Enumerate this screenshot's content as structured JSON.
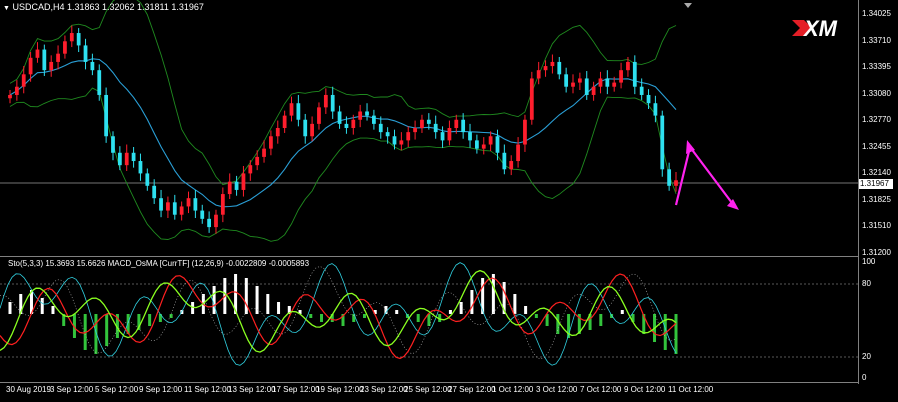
{
  "header": {
    "title": "USDCAD,H4  1.31863 1.32062 1.31811 1.31967",
    "menu_icon": "triangle-down-icon"
  },
  "indicator_header": {
    "text": "Sto(5,3,3) 15.3693 15.6626  MACD_OsMA [CurrTF] (12,26,9) -0.0022809 -0.0005893"
  },
  "brand": {
    "logo_text": "XM",
    "logo_color": "#e41e26"
  },
  "colors": {
    "bull_candle": "#ff1e2d",
    "bear_candle": "#2ee0f0",
    "bands": "#1f8a1f",
    "ma": "#2a9fd6",
    "arrow": "#ff22ee",
    "macd_pos": "#ffffff",
    "macd_neg": "#33c43c",
    "stoch_main": "#ff2020",
    "stoch_signal": "#8aff20",
    "sto_k": "#30d0e0"
  },
  "price_axis": [
    "1.34025",
    "1.33710",
    "1.33395",
    "1.33080",
    "1.32770",
    "1.32455",
    "1.32140",
    "1.31825",
    "1.31510",
    "1.31200"
  ],
  "current_price": "1.31967",
  "indicator_axis": [
    "100",
    "80",
    "20",
    "0"
  ],
  "time_axis": [
    "30 Aug 2019",
    "3 Sep 12:00",
    "5 Sep 12:00",
    "9 Sep 12:00",
    "11 Sep 12:00",
    "13 Sep 12:00",
    "17 Sep 12:00",
    "19 Sep 12:00",
    "23 Sep 12:00",
    "25 Sep 12:00",
    "27 Sep 12:00",
    "1 Oct 12:00",
    "3 Oct 12:00",
    "7 Oct 12:00",
    "9 Oct 12:00",
    "11 Oct 12:00"
  ],
  "chart_data": {
    "type": "candlestick",
    "symbol": "USDCAD",
    "timeframe": "H4",
    "ohlc_last": {
      "open": 1.31863,
      "high": 1.32062,
      "low": 1.31811,
      "close": 1.31967
    },
    "ylim": [
      1.3105,
      1.3415
    ],
    "closes": [
      1.33,
      1.331,
      1.3325,
      1.3345,
      1.3355,
      1.333,
      1.334,
      1.335,
      1.3365,
      1.3375,
      1.336,
      1.334,
      1.333,
      1.33,
      1.325,
      1.323,
      1.3215,
      1.323,
      1.322,
      1.3205,
      1.319,
      1.3175,
      1.316,
      1.317,
      1.3155,
      1.3165,
      1.3175,
      1.316,
      1.315,
      1.314,
      1.3155,
      1.318,
      1.3195,
      1.3185,
      1.3205,
      1.3215,
      1.3225,
      1.3235,
      1.325,
      1.326,
      1.3275,
      1.329,
      1.327,
      1.325,
      1.3265,
      1.3285,
      1.33,
      1.328,
      1.3265,
      1.326,
      1.327,
      1.328,
      1.3275,
      1.3265,
      1.3255,
      1.325,
      1.324,
      1.3245,
      1.3255,
      1.326,
      1.327,
      1.3265,
      1.3255,
      1.3245,
      1.326,
      1.327,
      1.3255,
      1.3245,
      1.3235,
      1.324,
      1.325,
      1.323,
      1.321,
      1.322,
      1.324,
      1.327,
      1.332,
      1.333,
      1.3335,
      1.334,
      1.3325,
      1.331,
      1.3315,
      1.332,
      1.33,
      1.331,
      1.332,
      1.331,
      1.3315,
      1.333,
      1.334,
      1.331,
      1.33,
      1.329,
      1.3275,
      1.321,
      1.319,
      1.31967
    ],
    "macd_histogram": [
      0.3,
      0.5,
      0.6,
      0.4,
      0.2,
      -0.3,
      -0.6,
      -0.9,
      -1.0,
      -0.8,
      -0.6,
      -0.5,
      -0.4,
      -0.3,
      -0.2,
      -0.1,
      0.1,
      0.3,
      0.5,
      0.7,
      0.9,
      1.0,
      0.9,
      0.7,
      0.5,
      0.3,
      0.2,
      0.1,
      -0.1,
      -0.2,
      -0.2,
      -0.3,
      -0.2,
      -0.1,
      0.1,
      0.2,
      0.1,
      -0.1,
      -0.2,
      -0.3,
      -0.2,
      0.1,
      0.3,
      0.6,
      0.9,
      1.0,
      0.8,
      0.5,
      0.2,
      -0.1,
      -0.3,
      -0.5,
      -0.6,
      -0.5,
      -0.4,
      -0.3,
      -0.1,
      0.1,
      -0.2,
      -0.5,
      -0.7,
      -0.9,
      -1.0
    ],
    "stochastic": {
      "k": 15.3693,
      "d": 15.6626,
      "levels": [
        80,
        20
      ]
    },
    "macd_osma": {
      "macd": -0.0022809,
      "osma": -0.0005893
    }
  }
}
